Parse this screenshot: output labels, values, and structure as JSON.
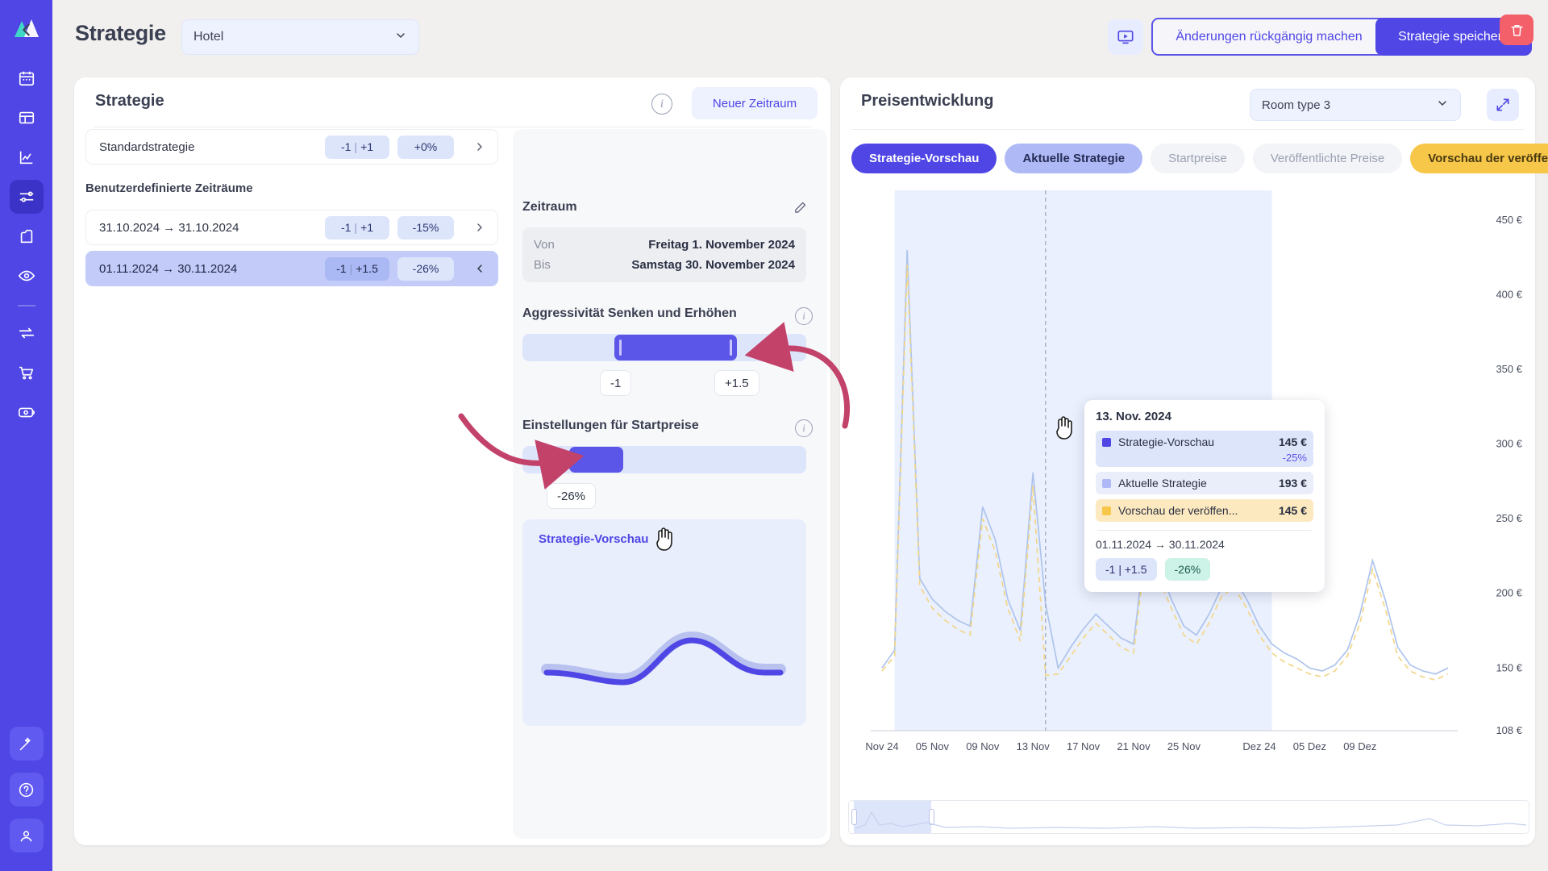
{
  "app": {
    "page_title": "Strategie",
    "hotel_select_value": "Hotel",
    "undo_label": "Änderungen rückgängig machen",
    "save_label": "Strategie speichern"
  },
  "sidebar": {
    "items": [
      {
        "icon": "logo-icon",
        "name": "app-logo"
      },
      {
        "icon": "calendar-icon",
        "name": "sidebar-item-calendar"
      },
      {
        "icon": "dashboard-icon",
        "name": "sidebar-item-dashboard"
      },
      {
        "icon": "analytics-icon",
        "name": "sidebar-item-analytics"
      },
      {
        "icon": "sliders-icon",
        "name": "sidebar-item-strategy",
        "active": true
      },
      {
        "icon": "report-icon",
        "name": "sidebar-item-reports"
      },
      {
        "icon": "eye-icon",
        "name": "sidebar-item-monitor"
      },
      {
        "icon": "divider",
        "name": "sidebar-divider"
      },
      {
        "icon": "sync-icon",
        "name": "sidebar-item-sync"
      },
      {
        "icon": "cart-icon",
        "name": "sidebar-item-market"
      },
      {
        "icon": "payments-icon",
        "name": "sidebar-item-payments"
      }
    ],
    "bottom": [
      {
        "icon": "magic-wand-icon",
        "name": "sidebar-item-assistant"
      },
      {
        "icon": "help-icon",
        "name": "sidebar-item-help"
      },
      {
        "icon": "user-icon",
        "name": "sidebar-item-account"
      }
    ]
  },
  "left_panel": {
    "title": "Strategie",
    "new_period_label": "Neuer Zeitraum",
    "info_icon": "info-icon",
    "default_row": {
      "label": "Standardstrategie",
      "aggressivity": {
        "down": "-1",
        "up": "+1"
      },
      "percent": "+0%"
    },
    "custom_periods_label": "Benutzerdefinierte Zeiträume",
    "periods": [
      {
        "label": "31.10.2024 → 31.10.2024",
        "aggressivity": {
          "down": "-1",
          "up": "+1"
        },
        "percent": "-15%",
        "selected": false
      },
      {
        "label": "01.11.2024 → 30.11.2024",
        "aggressivity": {
          "down": "-1",
          "up": "+1.5"
        },
        "percent": "-26%",
        "selected": true
      }
    ]
  },
  "detail_panel": {
    "back_icon": "chevron-left-icon",
    "delete_icon": "trash-icon",
    "zeitraum_title": "Zeitraum",
    "edit_icon": "pencil-icon",
    "von_label": "Von",
    "von_value": "Freitag 1. November 2024",
    "bis_label": "Bis",
    "bis_value": "Samstag 30. November 2024",
    "aggressivity_title": "Aggressivität Senken und Erhöhen",
    "aggressivity_min_chip": "-1",
    "aggressivity_max_chip": "+1.5",
    "startprice_title": "Einstellungen für Startpreise",
    "startprice_chip": "-26%",
    "preview_title": "Strategie-Vorschau"
  },
  "chart_panel": {
    "title": "Preisentwicklung",
    "room_type_value": "Room type 3",
    "expand_icon": "expand-icon",
    "tabs": [
      {
        "label": "Strategie-Vorschau",
        "style": "primary"
      },
      {
        "label": "Aktuelle Strategie",
        "style": "light"
      },
      {
        "label": "Startpreise",
        "style": "muted"
      },
      {
        "label": "Veröffentlichte Preise",
        "style": "muted"
      },
      {
        "label": "Vorschau der veröffentlichten Preise",
        "style": "amber"
      }
    ]
  },
  "tooltip": {
    "date": "13. Nov. 2024",
    "rows": [
      {
        "label": "Strategie-Vorschau",
        "value": "145 €",
        "sub": "-25%",
        "color": "#4f46e5",
        "bg": "#dde5fb"
      },
      {
        "label": "Aktuelle Strategie",
        "value": "193 €",
        "sub": "",
        "color": "#aeb9f6",
        "bg": "#eaeefb"
      },
      {
        "label": "Vorschau der veröffen...",
        "value": "145 €",
        "sub": "",
        "color": "#f7c74a",
        "bg": "#fce9bf"
      }
    ],
    "range": "01.11.2024 → 30.11.2024",
    "badge_aggr": "-1 | +1.5",
    "badge_pct": "-26%"
  },
  "colors": {
    "brand": "#4f46e5",
    "brand_light": "#aeb9f6",
    "amber": "#f7c74a",
    "danger": "#f4606a",
    "mint": "#cdf2e8",
    "annotation_arrow": "#c2426a"
  },
  "chart_data": {
    "type": "line",
    "title": "Preisentwicklung",
    "xlabel": "",
    "ylabel": "€",
    "ylim": [
      108,
      470
    ],
    "yticks": [
      450,
      400,
      350,
      300,
      250,
      200,
      150,
      108
    ],
    "ytick_labels": [
      "450 €",
      "400 €",
      "350 €",
      "300 €",
      "250 €",
      "200 €",
      "150 €",
      "108 €"
    ],
    "xtick_labels": [
      "Nov 24",
      "05 Nov",
      "09 Nov",
      "13 Nov",
      "17 Nov",
      "21 Nov",
      "25 Nov",
      "Dez 24",
      "05 Dez",
      "09 Dez"
    ],
    "grid": false,
    "legend_position": "tabs-above",
    "highlight_band": {
      "from": "01 Nov",
      "to": "30 Nov",
      "color": "#eaf0fd"
    },
    "cursor_line": {
      "x": "13 Nov",
      "style": "dashed"
    },
    "series": [
      {
        "name": "Aktuelle Strategie",
        "color": "#aec4ec",
        "style": "solid",
        "values": [
          150,
          162,
          430,
          210,
          196,
          188,
          182,
          178,
          258,
          236,
          196,
          175,
          281,
          193,
          150,
          164,
          176,
          186,
          178,
          170,
          166,
          240,
          218,
          196,
          178,
          172,
          186,
          204,
          210,
          196,
          178,
          166,
          160,
          156,
          150,
          148,
          152,
          162,
          186,
          222,
          196,
          164,
          152,
          148,
          146,
          150
        ]
      },
      {
        "name": "Vorschau der veröffentlichten Preise",
        "color": "#f2d68a",
        "style": "dashed",
        "values": [
          148,
          158,
          420,
          205,
          190,
          182,
          176,
          172,
          250,
          228,
          190,
          168,
          272,
          145,
          146,
          158,
          170,
          180,
          172,
          164,
          160,
          232,
          210,
          190,
          172,
          166,
          180,
          198,
          204,
          190,
          172,
          160,
          154,
          150,
          146,
          144,
          148,
          158,
          180,
          216,
          190,
          158,
          148,
          144,
          142,
          146
        ]
      }
    ]
  }
}
